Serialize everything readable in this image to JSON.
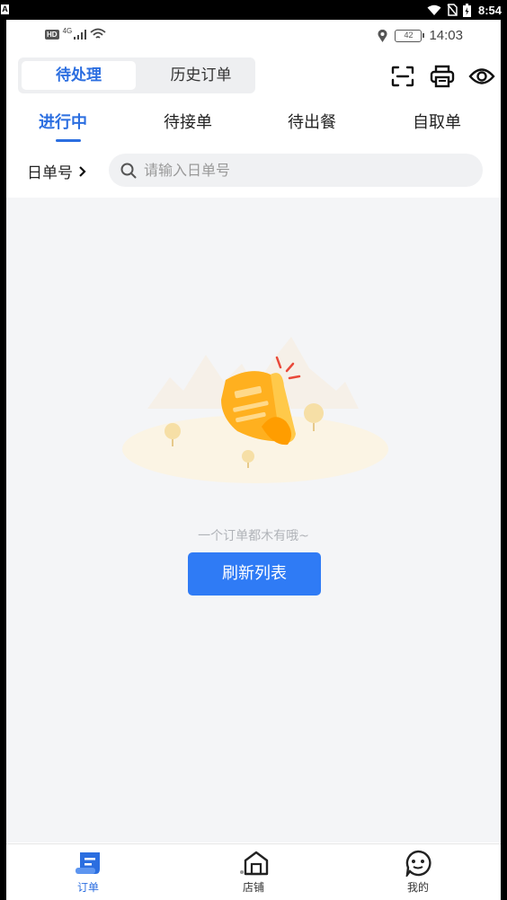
{
  "system_bar": {
    "time": "8:54"
  },
  "status_bar": {
    "network": "4G",
    "hd": "HD",
    "battery": "42",
    "time": "14:03"
  },
  "header": {
    "segments": [
      "待处理",
      "历史订单"
    ],
    "icons": [
      "scan-icon",
      "printer-icon",
      "eye-icon"
    ]
  },
  "tabs": [
    "进行中",
    "待接单",
    "待出餐",
    "自取单"
  ],
  "search": {
    "filter_label": "日单号",
    "placeholder": "请输入日单号"
  },
  "empty_state": {
    "message": "一个订单都木有哦~",
    "button": "刷新列表"
  },
  "bottom_nav": [
    "订单",
    "店铺",
    "我的"
  ],
  "colors": {
    "accent": "#2b6ee0",
    "button": "#2f7bf5",
    "content_bg": "#f4f5f7"
  }
}
